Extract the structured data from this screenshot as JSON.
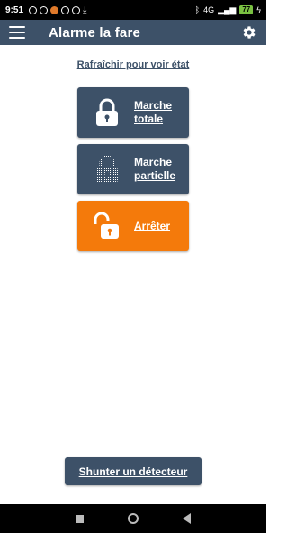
{
  "status_bar": {
    "time": "9:51",
    "battery": "77",
    "network": "4G"
  },
  "app_bar": {
    "title": "Alarme la fare"
  },
  "refresh_link": "Rafraîchir pour voir état",
  "buttons": [
    {
      "label": "Marche totale",
      "color": "#3d5168",
      "icon": "lock-closed-icon"
    },
    {
      "label": "Marche partielle",
      "color": "#3d5168",
      "icon": "lock-partial-icon"
    },
    {
      "label": "Arrêter",
      "color": "#f47a0b",
      "icon": "lock-open-icon"
    }
  ],
  "bypass_button": "Shunter un détecteur",
  "colors": {
    "primary": "#3d5168",
    "accent": "#f47a0b",
    "background": "#ffffff"
  }
}
